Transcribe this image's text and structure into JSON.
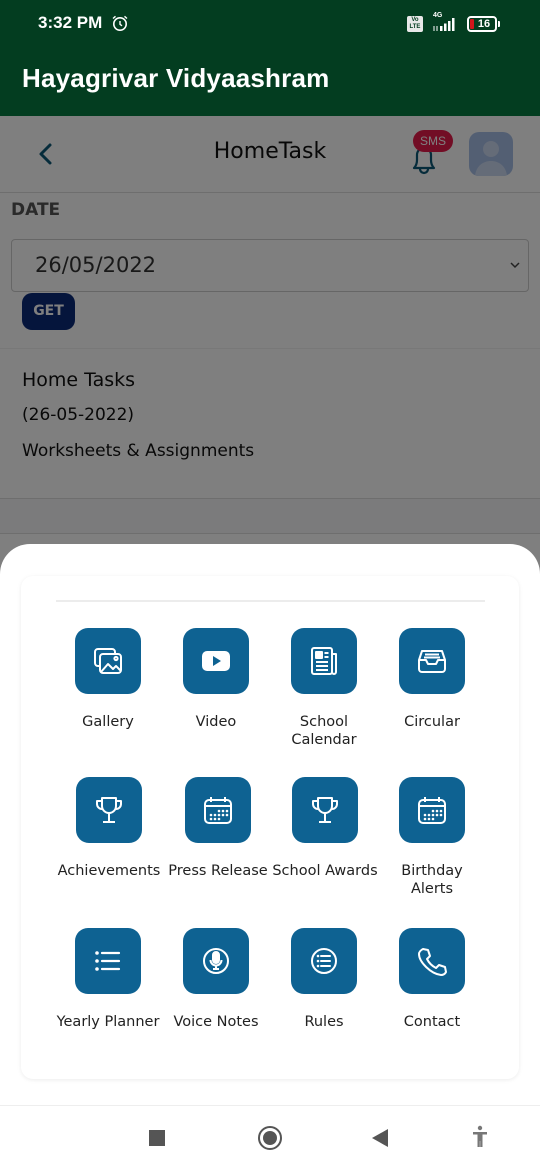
{
  "status_bar": {
    "time": "3:32 PM",
    "volte": "Vo LTE",
    "network": "4G",
    "battery": "16"
  },
  "app": {
    "title": "Hayagrivar Vidyaashram"
  },
  "top_nav": {
    "title": "HomeTask",
    "sms_badge": "SMS",
    "icons": {
      "back": "chevron-left-icon",
      "notifications": "bell-icon",
      "profile": "avatar-icon"
    }
  },
  "form": {
    "date_label": "DATE",
    "date_value": "26/05/2022",
    "get_label": "GET"
  },
  "tasks": {
    "title": "Home Tasks",
    "date": "(26-05-2022)",
    "items": [
      "Worksheets & Assignments"
    ]
  },
  "menu": {
    "accent_color": "#0e6292",
    "items": [
      {
        "label": "Gallery",
        "icon": "gallery-icon"
      },
      {
        "label": "Video",
        "icon": "video-icon"
      },
      {
        "label": "School Calendar",
        "icon": "newspaper-icon"
      },
      {
        "label": "Circular",
        "icon": "inbox-icon"
      },
      {
        "label": "Achievements",
        "icon": "trophy-icon"
      },
      {
        "label": "Press Release",
        "icon": "calendar-icon"
      },
      {
        "label": "School Awards",
        "icon": "trophy-icon"
      },
      {
        "label": "Birthday Alerts",
        "icon": "calendar-icon"
      },
      {
        "label": "Yearly Planner",
        "icon": "list-icon"
      },
      {
        "label": "Voice Notes",
        "icon": "microphone-icon"
      },
      {
        "label": "Rules",
        "icon": "list-circle-icon"
      },
      {
        "label": "Contact",
        "icon": "phone-icon"
      }
    ]
  },
  "system_nav": {
    "recents": "recents-icon",
    "home": "home-icon",
    "back": "back-icon",
    "accessibility": "accessibility-icon"
  }
}
